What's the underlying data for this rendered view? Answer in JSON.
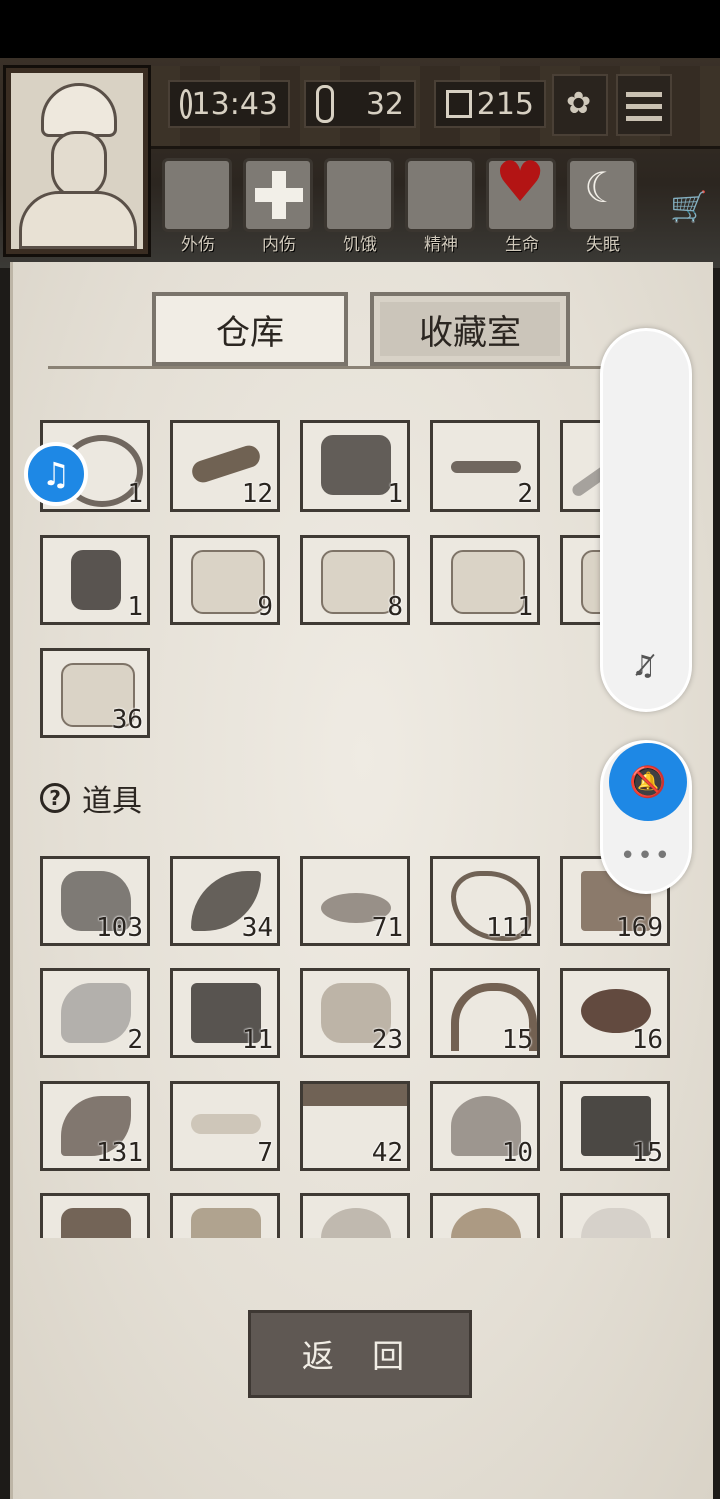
{
  "hud": {
    "time": "13:43",
    "temperature": "32",
    "day": "215"
  },
  "conditions": [
    {
      "label": "外伤",
      "icon": "bandaged-hand-icon"
    },
    {
      "label": "内伤",
      "icon": "medical-cross-icon"
    },
    {
      "label": "饥饿",
      "icon": "stomach-icon"
    },
    {
      "label": "精神",
      "icon": "head-icon"
    },
    {
      "label": "生命",
      "icon": "heart-icon",
      "color": "#b31414"
    },
    {
      "label": "失眠",
      "icon": "moon-icon"
    }
  ],
  "tabs": {
    "warehouse": "仓库",
    "collection": "收藏室"
  },
  "equipment": [
    {
      "name": "whip",
      "count": "1"
    },
    {
      "name": "wooden-club",
      "count": "12"
    },
    {
      "name": "fur-coat",
      "count": "1"
    },
    {
      "name": "crossbow",
      "count": "2"
    },
    {
      "name": "metal-bar",
      "count": ""
    },
    {
      "name": "hazmat-suit",
      "count": "1"
    },
    {
      "name": "food-crate",
      "count": "9"
    },
    {
      "name": "medical-crate",
      "count": "8"
    },
    {
      "name": "weapon-crate",
      "count": "1"
    },
    {
      "name": "tool-crate",
      "count": ""
    },
    {
      "name": "material-crate",
      "count": "36"
    }
  ],
  "props_section": {
    "label": "道具"
  },
  "props": [
    {
      "name": "stone",
      "count": "103"
    },
    {
      "name": "leaf",
      "count": "34"
    },
    {
      "name": "water-puddle",
      "count": "71"
    },
    {
      "name": "vine",
      "count": "111"
    },
    {
      "name": "planks",
      "count": "169"
    },
    {
      "name": "flint",
      "count": "2"
    },
    {
      "name": "ore",
      "count": "11"
    },
    {
      "name": "animal-hide",
      "count": "23"
    },
    {
      "name": "worm",
      "count": "15"
    },
    {
      "name": "tar",
      "count": "16"
    },
    {
      "name": "herb",
      "count": "131"
    },
    {
      "name": "bones",
      "count": "7"
    },
    {
      "name": "resin",
      "count": "42"
    },
    {
      "name": "pearl",
      "count": "10"
    },
    {
      "name": "charcoal",
      "count": "15"
    },
    {
      "name": "dirt",
      "count": ""
    },
    {
      "name": "gold-nuggets",
      "count": ""
    },
    {
      "name": "cotton",
      "count": ""
    },
    {
      "name": "sponge",
      "count": ""
    },
    {
      "name": "salt",
      "count": ""
    }
  ],
  "return_button": "返 回"
}
